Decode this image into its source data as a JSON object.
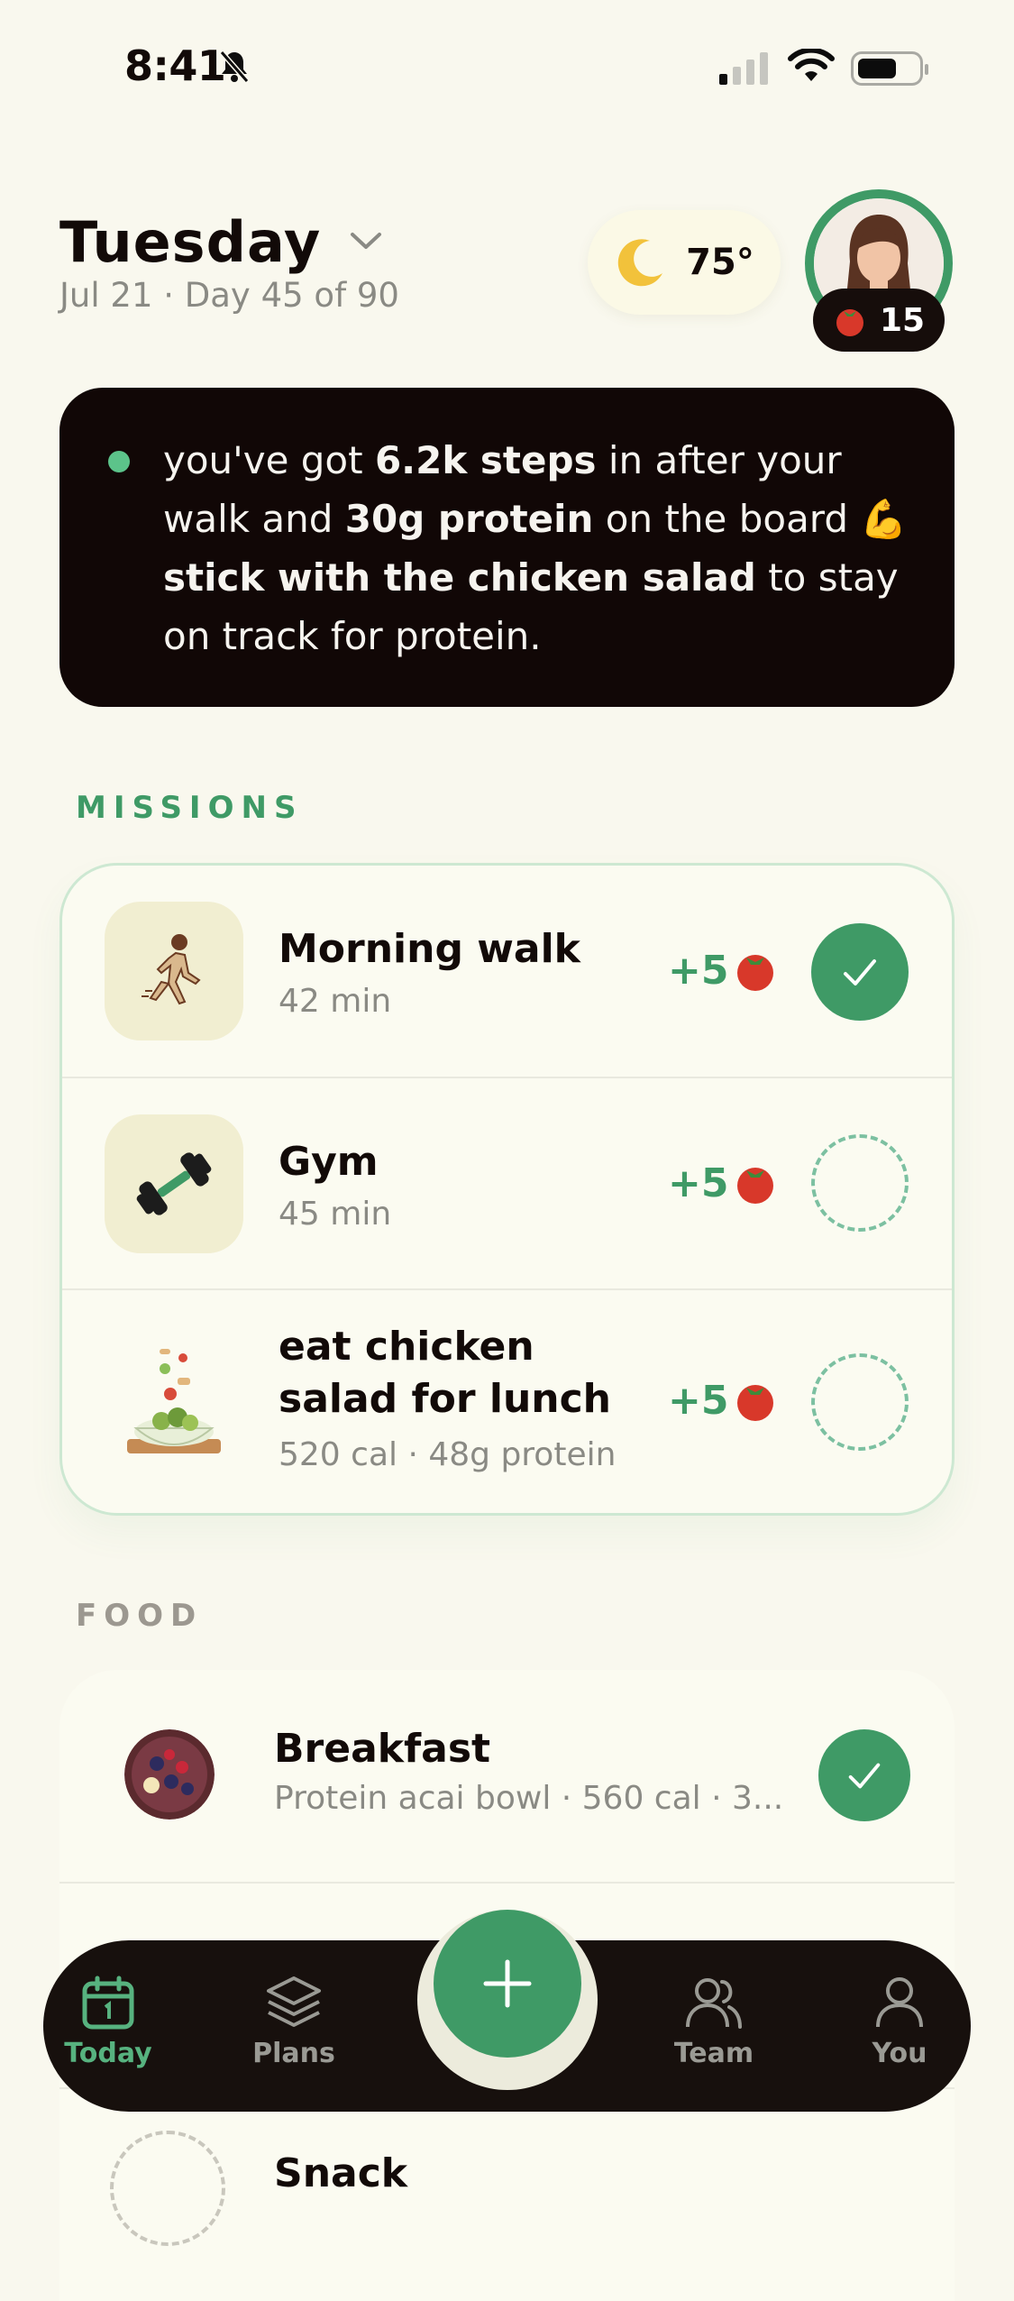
{
  "status_bar": {
    "time": "8:41"
  },
  "header": {
    "day": "Tuesday",
    "subtitle": "Jul 21 · Day 45 of 90",
    "weather_temp": "75°",
    "tomato_count": "15"
  },
  "coach": {
    "t1": "you've got ",
    "b1": "6.2k steps",
    "t2": " in after your walk and ",
    "b2": "30g protein",
    "t3": " on the board 💪 ",
    "b3": "stick with the chicken salad",
    "t4": " to stay on track for protein."
  },
  "missions": {
    "label": "MISSIONS",
    "items": [
      {
        "title": "Morning walk",
        "subtitle": "42 min",
        "points": "+5",
        "done": true
      },
      {
        "title": "Gym",
        "subtitle": "45 min",
        "points": "+5",
        "done": false
      },
      {
        "title": "eat chicken salad for lunch",
        "subtitle": "520 cal · 48g protein",
        "points": "+5",
        "done": false
      }
    ]
  },
  "food": {
    "label": "FOOD",
    "items": [
      {
        "title": "Breakfast",
        "subtitle": "Protein acai bowl · 560 cal · 3...",
        "done": true
      },
      {
        "title": "Snack",
        "subtitle": ""
      }
    ]
  },
  "tabbar": {
    "tabs": [
      {
        "label": "Today",
        "active": true
      },
      {
        "label": "Plans"
      },
      {
        "label": "Team"
      },
      {
        "label": "You"
      }
    ],
    "fab_icon": "plus-icon"
  },
  "colors": {
    "accent": "#3f9a66",
    "background": "#f9f8ee",
    "dark": "#110706"
  }
}
